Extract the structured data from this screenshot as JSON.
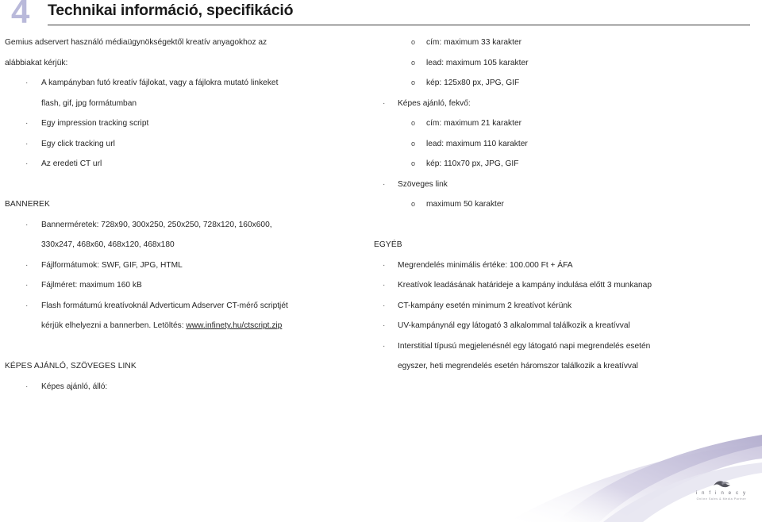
{
  "header": {
    "number": "4",
    "title": "Technikai információ, specifikáció"
  },
  "colors": {
    "number_accent": "#b9b9da",
    "swoosh_light": "#e3e1ee",
    "swoosh_mid": "#c9c5de",
    "swoosh_dark": "#b7b2d2",
    "text": "#262626",
    "rule": "#3a3a3a"
  },
  "bullets": {
    "level1_glyph": "·",
    "level2_glyph": "o"
  },
  "left_column": {
    "intro_line_1": "Gemius adservert használó médiaügynökségektől kreatív anyagokhoz az",
    "intro_line_2": "alábbiakat kérjük:",
    "items": [
      {
        "text": "A kampányban futó kreatív fájlokat, vagy a fájlokra mutató linkeket",
        "cont": "flash, gif, jpg formátumban"
      },
      {
        "text": "Egy impression tracking script"
      },
      {
        "text": "Egy click tracking url"
      },
      {
        "text": "Az eredeti CT url"
      }
    ],
    "bannerek_heading": "BANNEREK",
    "bannerek_items": [
      {
        "text": "Bannerméretek: 728x90, 300x250, 250x250, 728x120, 160x600,",
        "cont": "330x247, 468x60,  468x120, 468x180"
      },
      {
        "text": "Fájlformátumok: SWF, GIF, JPG, HTML"
      },
      {
        "text": "Fájlméret: maximum 160 kB"
      },
      {
        "text": "Flash formátumú kreatívoknál Adverticum Adserver CT-mérő scriptjét"
      }
    ],
    "flash_cont_prefix": "kérjük elhelyezni a bannerben. Letöltés: ",
    "flash_cont_link": "www.infinety.hu/ctscript.zip",
    "kepes_heading": "KÉPES AJÁNLÓ, SZÖVEGES LINK",
    "kepes_items": [
      {
        "text": "Képes ajánló, álló:"
      }
    ]
  },
  "right_column": {
    "allo_subitems": [
      "cím: maximum 33 karakter",
      "lead: maximum 105 karakter",
      "kép: 125x80 px, JPG, GIF"
    ],
    "fekvo_label": "Képes ajánló, fekvő:",
    "fekvo_subitems": [
      "cím: maximum 21 karakter",
      "lead: maximum 110 karakter",
      "kép: 110x70 px, JPG, GIF"
    ],
    "szoveges_label": "Szöveges link",
    "szoveges_subitems": [
      "maximum 50 karakter"
    ],
    "egyeb_heading": "EGYÉB",
    "egyeb_items": [
      {
        "text": "Megrendelés minimális értéke: 100.000 Ft + ÁFA"
      },
      {
        "text": "Kreatívok leadásának határideje a kampány indulása előtt 3 munkanap"
      },
      {
        "text": "CT-kampány esetén minimum 2 kreatívot kérünk"
      },
      {
        "text": "UV-kampánynál egy látogató 3 alkalommal találkozik a kreatívval"
      },
      {
        "text": "Interstitial típusú megjelenésnél egy látogató napi megrendelés esetén",
        "cont": "egyszer, heti megrendelés esetén háromszor találkozik a kreatívval"
      }
    ]
  },
  "logo": {
    "wordmark": "i n f i n e c y",
    "tagline": "Online Sales & Media Partner"
  }
}
